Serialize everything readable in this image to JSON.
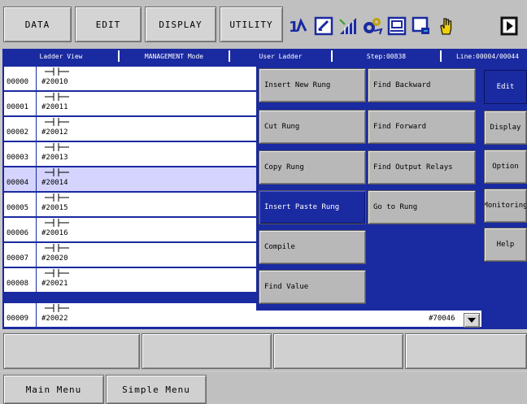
{
  "top_menu": {
    "items": [
      {
        "label": "DATA"
      },
      {
        "label": "EDIT"
      },
      {
        "label": "DISPLAY"
      },
      {
        "label": "UTILITY"
      }
    ],
    "toolbar_icons": [
      "step-icon",
      "edit-window-icon",
      "chart-icon",
      "gears-icon",
      "io-monitor-icon",
      "window-arrow-icon",
      "hand-icon",
      "play-icon"
    ]
  },
  "status_bar": {
    "view": "Ladder View",
    "mode": "MANAGEMENT Mode",
    "program": "User Ladder",
    "step": "Step:00838",
    "line": "Line:00004/00044"
  },
  "ladder": {
    "rows": [
      {
        "num": "00000",
        "label": "#20010",
        "selected": false
      },
      {
        "num": "00001",
        "label": "#20011",
        "selected": false
      },
      {
        "num": "00002",
        "label": "#20012",
        "selected": false
      },
      {
        "num": "00003",
        "label": "#20013",
        "selected": false
      },
      {
        "num": "00004",
        "label": "#20014",
        "selected": true
      },
      {
        "num": "00005",
        "label": "#20015",
        "selected": false
      },
      {
        "num": "00006",
        "label": "#20016",
        "selected": false
      },
      {
        "num": "00007",
        "label": "#20020",
        "selected": false
      },
      {
        "num": "00008",
        "label": "#20021",
        "selected": false
      },
      {
        "num": "00009",
        "label": "#20022",
        "selected": false
      }
    ],
    "last_row_output": "#70046"
  },
  "popup_menu": {
    "left": [
      {
        "label": "Insert New Rung",
        "active": false
      },
      {
        "label": "Cut Rung",
        "active": false
      },
      {
        "label": "Copy Rung",
        "active": false
      },
      {
        "label": "Insert Paste Rung",
        "active": true
      },
      {
        "label": "Compile",
        "active": false
      },
      {
        "label": "Find Value",
        "active": false
      }
    ],
    "right": [
      {
        "label": "Find Backward"
      },
      {
        "label": "Find Forward"
      },
      {
        "label": "Find Output Relays"
      },
      {
        "label": "Go to Rung"
      }
    ]
  },
  "side_tabs": [
    {
      "label": "Edit",
      "active": true
    },
    {
      "label": "Display",
      "active": false
    },
    {
      "label": "Option",
      "active": false
    },
    {
      "label": "Monitoring",
      "active": false
    },
    {
      "label": "Help",
      "active": false
    }
  ],
  "bottom": {
    "main_menu": "Main Menu",
    "simple_menu": "Simple Menu"
  },
  "colors": {
    "frame_blue": "#1a2aa0",
    "selected_row": "#d4d4ff",
    "button_gray": "#b8b8b8"
  }
}
